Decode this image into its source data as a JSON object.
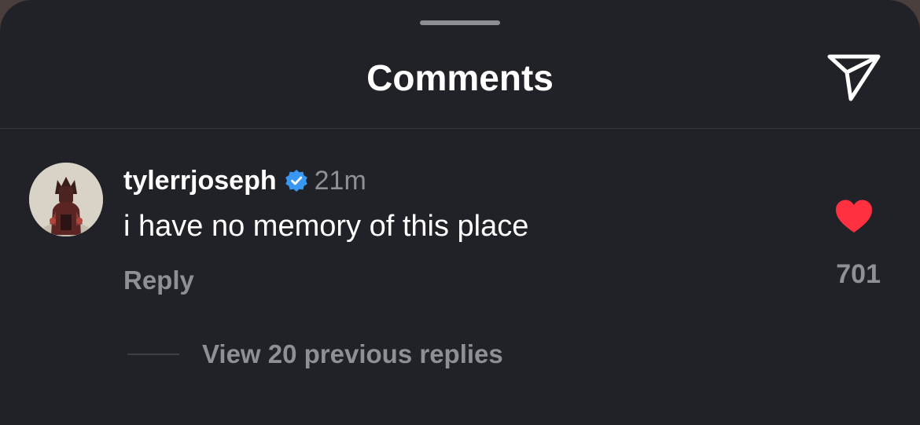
{
  "sheet": {
    "title": "Comments",
    "share_icon": "paper-plane-icon"
  },
  "comment": {
    "username": "tylerrjoseph",
    "verified_icon": "verified-badge-icon",
    "verified_color": "#3897f0",
    "time": "21m",
    "text": "i have no memory of this place",
    "reply_label": "Reply",
    "like_icon": "heart-filled-icon",
    "like_color": "#ff3040",
    "like_count": "701",
    "view_replies_label": "View 20 previous replies"
  }
}
